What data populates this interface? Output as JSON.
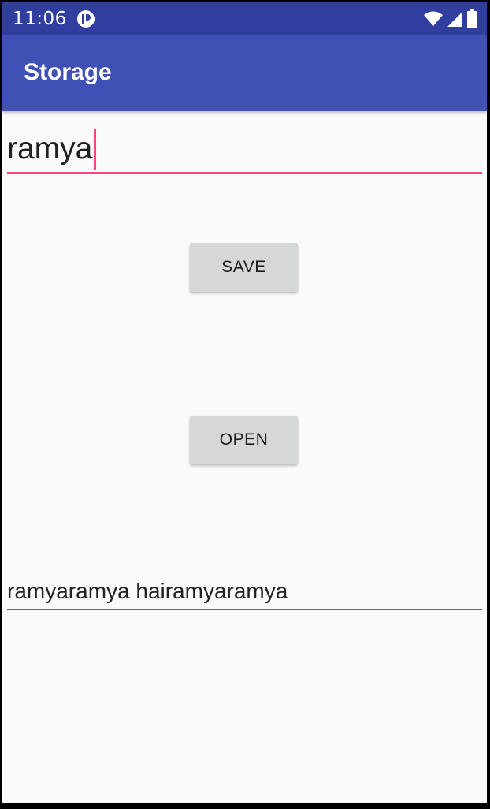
{
  "status_bar": {
    "time": "11:06",
    "icons": [
      "notification-app-icon",
      "wifi-icon",
      "cell-signal-icon",
      "battery-icon"
    ]
  },
  "app_bar": {
    "title": "Storage"
  },
  "input": {
    "value": "ramya"
  },
  "buttons": {
    "save_label": "SAVE",
    "open_label": "OPEN"
  },
  "output": {
    "value": "ramyaramya hairamyaramya"
  },
  "colors": {
    "status_bar": "#303f9f",
    "app_bar": "#3f51b5",
    "accent": "#ff4081",
    "background": "#fafafa",
    "button": "#d6d7d7"
  }
}
